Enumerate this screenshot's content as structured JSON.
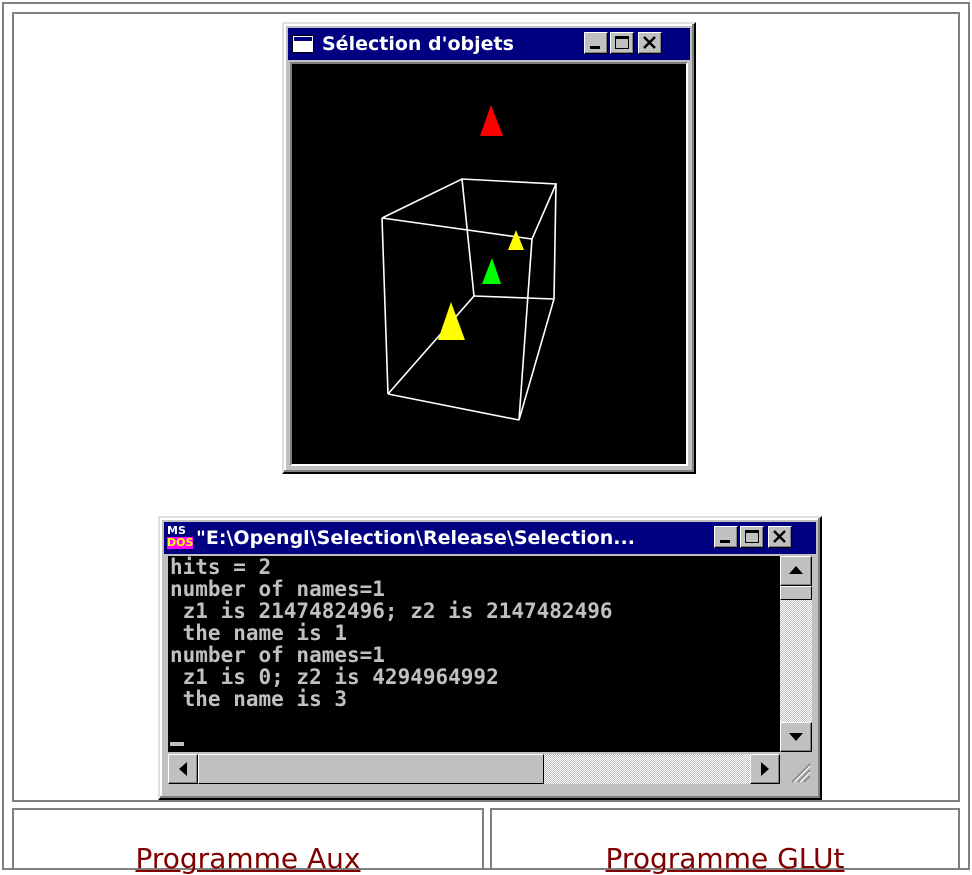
{
  "gl_window": {
    "title": "Sélection d'objets",
    "icon": "window-icon",
    "buttons": [
      "minimize-icon",
      "maximize-icon",
      "close-icon"
    ],
    "scene": {
      "background": "#000000",
      "wire_color": "#ffffff",
      "cones": [
        {
          "name": "cone-red",
          "color": "#ff0000"
        },
        {
          "name": "cone-yellow-small",
          "color": "#ffff00"
        },
        {
          "name": "cone-green",
          "color": "#00ff00"
        },
        {
          "name": "cone-yellow-large",
          "color": "#ffff00"
        }
      ]
    }
  },
  "console_window": {
    "title": "\"E:\\Opengl\\Selection\\Release\\Selection...",
    "icon": "ms-dos-icon",
    "icon_text": {
      "top": "MS",
      "bottom": "DOS"
    },
    "lines": [
      "hits = 2",
      "number of names=1",
      " z1 is 2147482496; z2 is 2147482496",
      " the name is 1",
      "number of names=1",
      " z1 is 0; z2 is 4294964992",
      " the name is 3"
    ]
  },
  "links": {
    "left": "Programme Aux",
    "right": "Programme GLUt"
  },
  "colors": {
    "link": "#800000",
    "titlebar": "#000080",
    "window_face": "#c0c0c0"
  }
}
